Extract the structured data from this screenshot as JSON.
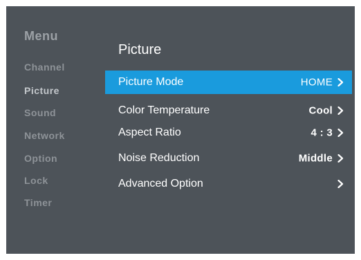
{
  "sidebar": {
    "title": "Menu",
    "items": [
      {
        "label": "Channel"
      },
      {
        "label": "Picture"
      },
      {
        "label": "Sound"
      },
      {
        "label": "Network"
      },
      {
        "label": "Option"
      },
      {
        "label": "Lock"
      },
      {
        "label": "Timer"
      }
    ],
    "active_item": "Picture"
  },
  "panel": {
    "title": "Picture",
    "rows": [
      {
        "label": "Picture Mode",
        "value": "HOME",
        "selected": true
      },
      {
        "label": "Color Temperature",
        "value": "Cool"
      },
      {
        "label": "Aspect Ratio",
        "value": "4 : 3"
      },
      {
        "label": "Noise Reduction",
        "value": "Middle"
      },
      {
        "label": "Advanced Option",
        "value": ""
      }
    ]
  },
  "colors": {
    "background": "#4d5359",
    "highlight": "#1a9bdd",
    "sidebar_text": "#8e9398",
    "text": "#ffffff"
  },
  "icons": {
    "row_arrow": "chevron-right-icon"
  }
}
